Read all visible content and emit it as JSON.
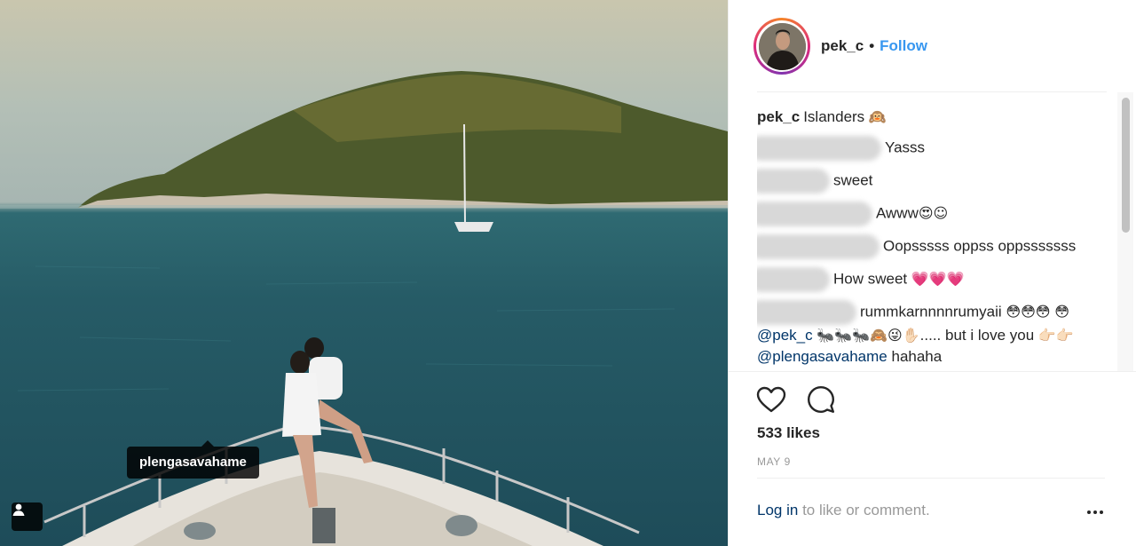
{
  "photo": {
    "tagged_user": "plengasavahame"
  },
  "header": {
    "username": "pek_c",
    "separator": "•",
    "follow_label": "Follow"
  },
  "comments": [
    {
      "user": "pek_c",
      "text": "Islanders",
      "emoji": "🙉"
    },
    {
      "user_hidden": true,
      "text": "Yasss"
    },
    {
      "user_hidden": true,
      "text": "sweet"
    },
    {
      "user_hidden": true,
      "text": "Awww",
      "emoji": "😍☺"
    },
    {
      "user_hidden": true,
      "text": "Oopsssss oppss oppsssssss"
    },
    {
      "user_hidden": true,
      "text": "How sweet",
      "emoji": "💗💗💗"
    },
    {
      "user_hidden": true,
      "text": "rummkarnnnnrumyaii",
      "emoji": "😳😳😳",
      "line2_emoji": "😳",
      "mention1": "@pek_c",
      "mid_emoji": "🐜🐜🐜🙈😜✋🏻",
      "mid_text": "..... but i love you",
      "line3_emoji": "👉🏻👉🏻",
      "mention2": "@plengasavahame",
      "end_text": "hahaha"
    }
  ],
  "actions": {
    "like_icon": "heart-icon",
    "comment_icon": "comment-bubble-icon"
  },
  "likes_text": "533 likes",
  "date_text": "MAY 9",
  "footer": {
    "login_link": "Log in",
    "login_rest": "to like or comment.",
    "more_icon": "ellipsis-icon"
  },
  "colors": {
    "link_blue": "#3897f0",
    "mention_navy": "#003569",
    "muted_grey": "#999999"
  }
}
